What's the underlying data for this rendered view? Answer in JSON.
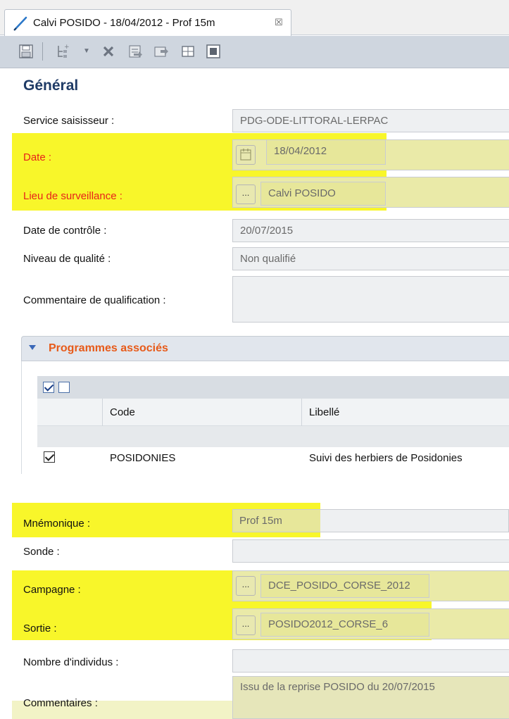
{
  "tab": {
    "icon": "pencil-icon",
    "label": "Calvi POSIDO - 18/04/2012 - Prof 15m",
    "close_icon": "close-icon"
  },
  "toolbar": {
    "icons": [
      "save-icon",
      "add-child-icon",
      "dropdown-arrow-icon",
      "delete-icon",
      "import-icon",
      "export-icon",
      "table-icon",
      "stop-icon"
    ]
  },
  "section": {
    "title": "Général"
  },
  "form": {
    "service_saisisseur": {
      "label": "Service saisisseur :",
      "value": "PDG-ODE-LITTORAL-LERPAC"
    },
    "date": {
      "label": "Date :",
      "value": "18/04/2012",
      "button_icon": "calendar-icon"
    },
    "lieu": {
      "label": "Lieu de surveillance :",
      "value": "Calvi POSIDO",
      "button_label": "..."
    },
    "date_controle": {
      "label": "Date de contrôle :",
      "value": "20/07/2015"
    },
    "niveau_qualite": {
      "label": "Niveau de qualité :",
      "value": "Non qualifié"
    },
    "commentaire_qualif": {
      "label": "Commentaire de qualification :",
      "value": ""
    },
    "mnemonique": {
      "label": "Mnémonique :",
      "value": "Prof 15m"
    },
    "sonde": {
      "label": "Sonde :",
      "value": ""
    },
    "campagne": {
      "label": "Campagne :",
      "value": "DCE_POSIDO_CORSE_2012",
      "button_label": "..."
    },
    "sortie": {
      "label": "Sortie :",
      "value": "POSIDO2012_CORSE_6",
      "button_label": "..."
    },
    "nombre_individus": {
      "label": "Nombre d'individus :",
      "value": ""
    },
    "commentaires": {
      "label": "Commentaires :",
      "value": "Issu de la reprise POSIDO du 20/07/2015"
    }
  },
  "programmes": {
    "title": "Programmes associés",
    "columns": {
      "code": "Code",
      "libelle": "Libellé"
    },
    "rows": [
      {
        "checked": true,
        "code": "POSIDONIES",
        "libelle": "Suivi des herbiers de Posidonies"
      }
    ]
  },
  "colors": {
    "highlight": "#f8f62a",
    "required_label": "#e8221a",
    "section_title": "#1f3b66",
    "programmes_title": "#e75a19"
  }
}
